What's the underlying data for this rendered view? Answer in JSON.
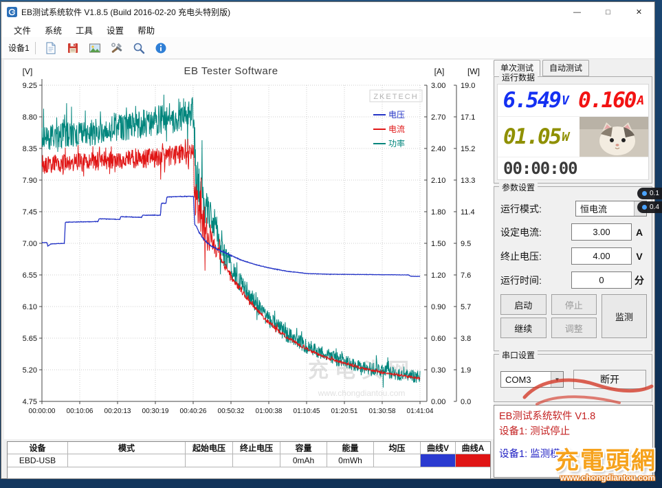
{
  "window": {
    "title": "EB测试系统软件 V1.8.5 (Build 2016-02-20 充电头特别版)",
    "minimize": "—",
    "maximize": "□",
    "close": "✕"
  },
  "menu": {
    "items": [
      "文件",
      "系统",
      "工具",
      "设置",
      "帮助"
    ]
  },
  "toolbar": {
    "device_label": "设备1",
    "icons": [
      "new-file-icon",
      "save-icon",
      "image-icon",
      "tools-icon",
      "zoom-icon",
      "info-icon"
    ]
  },
  "glyphs": {
    "dropdown": "▼"
  },
  "right_panel": {
    "tabs": [
      {
        "label": "单次测试"
      },
      {
        "label": "自动测试"
      }
    ],
    "run_data": {
      "group_label": "运行数据",
      "voltage_value": "6.549",
      "voltage_unit": "V",
      "voltage_color": "#1430f2",
      "current_value": "0.160",
      "current_unit": "A",
      "current_color": "#f21212",
      "power_value": "01.05",
      "power_unit": "W",
      "power_color": "#8f9000",
      "timer": "00:00:00",
      "timer_color": "#3a3a3a"
    },
    "params": {
      "group_label": "参数设置",
      "rows": [
        {
          "label": "运行模式:",
          "value": "恒电流"
        },
        {
          "label": "设定电流:",
          "value": "3.00",
          "suffix": "A"
        },
        {
          "label": "终止电压:",
          "value": "4.00",
          "suffix": "V"
        },
        {
          "label": "运行时间:",
          "value": "0",
          "suffix": "分"
        }
      ],
      "buttons": {
        "start": "启动",
        "stop": "停止",
        "monitor": "监测",
        "resume": "继续",
        "adjust": "调整"
      }
    },
    "serial": {
      "group_label": "串口设置",
      "port": "COM3",
      "disconnect_label": "断开"
    },
    "status": {
      "lines": [
        {
          "text": "EB测试系统软件 V1.8",
          "color": "#c42222"
        },
        {
          "text": "设备1: 测试停止",
          "color": "#c42222"
        },
        {
          "text": "设备1: 监测模式",
          "color": "#2222c4"
        }
      ]
    }
  },
  "table": {
    "headers": [
      "设备",
      "模式",
      "起始电压",
      "终止电压",
      "容量",
      "能量",
      "均压",
      "曲线V",
      "曲线A"
    ],
    "row": [
      "EBD-USB",
      "",
      "",
      "",
      "0mAh",
      "0mWh",
      "",
      "",
      ""
    ],
    "curve_v_color": "#2a3ad0",
    "curve_a_color": "#e01515"
  },
  "overlay": {
    "values": [
      "0.1",
      "0.4"
    ]
  },
  "watermarks": {
    "zketech": "ZKETECH",
    "chart_name": "充电头网",
    "chart_url": "www.chongdiantou.com",
    "logo_name": "充電頭網",
    "logo_url": "www.chongdiantou.com"
  },
  "chart_data": {
    "type": "line",
    "title": "EB Tester Software",
    "grid": true,
    "legend_position": "top-right",
    "axes": {
      "v": {
        "label": "[V]",
        "min": 4.75,
        "max": 9.25,
        "ticks": [
          "9.25",
          "8.80",
          "8.35",
          "7.90",
          "7.45",
          "7.00",
          "6.55",
          "6.10",
          "5.65",
          "5.20",
          "4.75"
        ]
      },
      "a": {
        "label": "[A]",
        "min": 0,
        "max": 3,
        "ticks": [
          "3.00",
          "2.70",
          "2.40",
          "2.10",
          "1.80",
          "1.50",
          "1.20",
          "0.90",
          "0.60",
          "0.30",
          "0.00"
        ]
      },
      "w": {
        "label": "[W]",
        "min": 0,
        "max": 19,
        "ticks": [
          "19.0",
          "17.1",
          "15.2",
          "13.3",
          "11.4",
          "9.5",
          "7.6",
          "5.7",
          "3.8",
          "1.9",
          "0.0"
        ]
      },
      "t": {
        "min": 0,
        "max": 6064,
        "ticks": [
          "00:00:00",
          "00:10:06",
          "00:20:13",
          "00:30:19",
          "00:40:26",
          "00:50:32",
          "01:00:38",
          "01:10:45",
          "01:20:51",
          "01:30:58",
          "01:41:04"
        ]
      }
    },
    "series": [
      {
        "name": "电压",
        "axis": "v",
        "color": "#2333c6",
        "points": [
          [
            0,
            7.01,
            0.002
          ],
          [
            80,
            7.01,
            0.002
          ],
          [
            95,
            6.96,
            0.002
          ],
          [
            140,
            6.99,
            0.002
          ],
          [
            360,
            7.0,
            0.002
          ],
          [
            375,
            7.3,
            0.003
          ],
          [
            900,
            7.31,
            0.003
          ],
          [
            915,
            7.35,
            0.003
          ],
          [
            1250,
            7.34,
            0.003
          ],
          [
            1265,
            7.38,
            0.003
          ],
          [
            1600,
            7.37,
            0.003
          ],
          [
            1615,
            7.4,
            0.003
          ],
          [
            1900,
            7.4,
            0.003
          ],
          [
            1915,
            7.57,
            0.003
          ],
          [
            1990,
            7.57,
            0.003
          ],
          [
            2005,
            7.66,
            0.003
          ],
          [
            2430,
            7.67,
            0.004
          ],
          [
            2450,
            7.28,
            0.012
          ],
          [
            2520,
            7.16,
            0.01
          ],
          [
            2600,
            7.05,
            0.009
          ],
          [
            2700,
            6.97,
            0.008
          ],
          [
            2850,
            6.9,
            0.007
          ],
          [
            3000,
            6.84,
            0.006
          ],
          [
            3200,
            6.76,
            0.005
          ],
          [
            3450,
            6.69,
            0.004
          ],
          [
            3700,
            6.64,
            0.004
          ],
          [
            3950,
            6.6,
            0.003
          ],
          [
            4250,
            6.57,
            0.003
          ],
          [
            4600,
            6.56,
            0.002
          ],
          [
            5880,
            6.55,
            0.002
          ],
          [
            5920,
            6.53,
            0.002
          ],
          [
            6064,
            6.53,
            0.002
          ]
        ]
      },
      {
        "name": "电流",
        "axis": "a",
        "color": "#e01515",
        "points": [
          [
            0,
            2.24,
            0.09
          ],
          [
            400,
            2.26,
            0.09
          ],
          [
            900,
            2.28,
            0.09
          ],
          [
            1500,
            2.3,
            0.09
          ],
          [
            1900,
            2.31,
            0.095
          ],
          [
            2050,
            2.33,
            0.1
          ],
          [
            2430,
            2.34,
            0.1
          ],
          [
            2455,
            1.92,
            0.22
          ],
          [
            2550,
            1.78,
            0.22
          ],
          [
            2650,
            1.6,
            0.18
          ],
          [
            2750,
            1.5,
            0.1
          ],
          [
            2900,
            1.32,
            0.04
          ],
          [
            3100,
            1.13,
            0.03
          ],
          [
            3300,
            0.97,
            0.025
          ],
          [
            3600,
            0.77,
            0.02
          ],
          [
            3900,
            0.62,
            0.018
          ],
          [
            4200,
            0.51,
            0.015
          ],
          [
            4500,
            0.43,
            0.014
          ],
          [
            4800,
            0.37,
            0.012
          ],
          [
            5100,
            0.32,
            0.012
          ],
          [
            5400,
            0.28,
            0.01
          ],
          [
            5700,
            0.25,
            0.01
          ],
          [
            6064,
            0.22,
            0.01
          ]
        ]
      },
      {
        "name": "功率",
        "axis": "w",
        "color": "#00857c",
        "points": [
          [
            0,
            15.8,
            0.8
          ],
          [
            400,
            16.0,
            0.8
          ],
          [
            900,
            16.2,
            0.8
          ],
          [
            1500,
            16.6,
            0.85
          ],
          [
            1900,
            16.9,
            0.9
          ],
          [
            2100,
            17.1,
            0.95
          ],
          [
            2350,
            17.3,
            1.0
          ],
          [
            2430,
            17.4,
            1.0
          ],
          [
            2455,
            13.9,
            1.5
          ],
          [
            2550,
            12.8,
            1.3
          ],
          [
            2650,
            11.4,
            1.1
          ],
          [
            2750,
            10.6,
            0.9
          ],
          [
            2900,
            9.0,
            0.7
          ],
          [
            3100,
            7.6,
            0.6
          ],
          [
            3300,
            6.5,
            0.55
          ],
          [
            3600,
            5.1,
            0.5
          ],
          [
            3900,
            4.1,
            0.48
          ],
          [
            4200,
            3.4,
            0.46
          ],
          [
            4500,
            2.85,
            0.44
          ],
          [
            4800,
            2.45,
            0.42
          ],
          [
            5100,
            2.1,
            0.4
          ],
          [
            5400,
            1.85,
            0.4
          ],
          [
            5700,
            1.65,
            0.38
          ],
          [
            6064,
            1.45,
            0.38
          ]
        ]
      }
    ]
  }
}
